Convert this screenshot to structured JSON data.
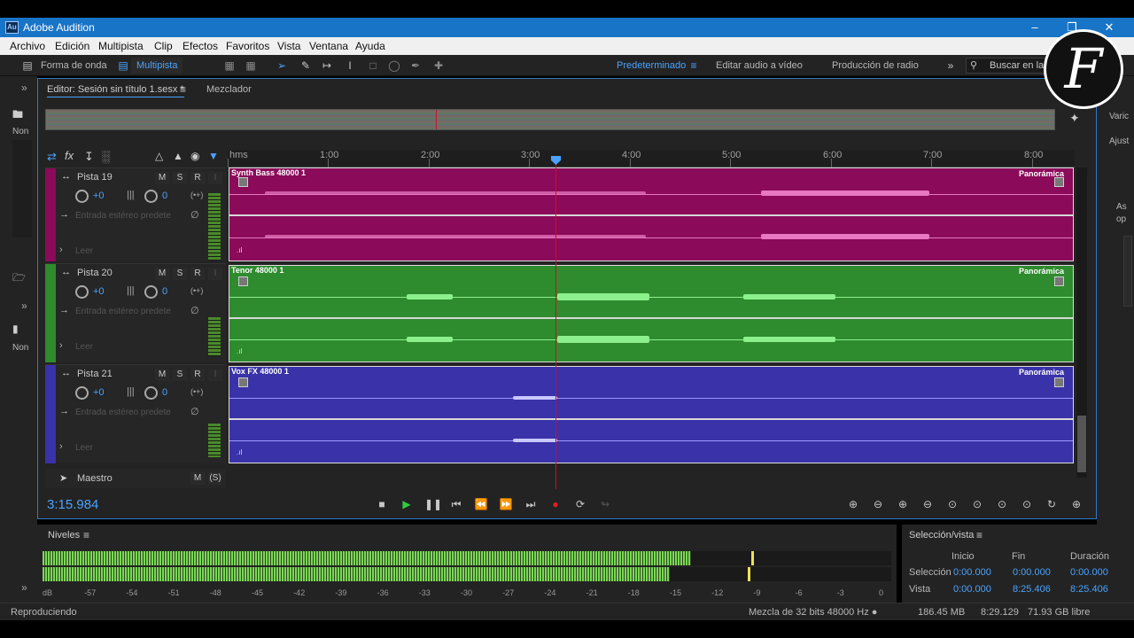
{
  "window": {
    "title": "Adobe Audition",
    "app_icon": "Au"
  },
  "menu": [
    "Archivo",
    "Edición",
    "Multipista",
    "Clip",
    "Efectos",
    "Favoritos",
    "Vista",
    "Ventana",
    "Ayuda"
  ],
  "toolbar": {
    "waveform_label": "Forma de onda",
    "multitrack_label": "Multipista",
    "workspaces": [
      "Predeterminado",
      "Editar audio a vídeo",
      "Producción de radio"
    ],
    "search_placeholder": "Buscar en la A"
  },
  "left_panel": {
    "label_top": "Non",
    "label_bottom": "Non"
  },
  "right_panel": {
    "labels": [
      "Varic",
      "Ajust",
      "As",
      "op"
    ]
  },
  "editor": {
    "tab_editor": "Editor: Sesión sin título 1.sesx *",
    "tab_mixer": "Mezclador",
    "ruler": [
      "hms",
      "1:00",
      "2:00",
      "3:00",
      "4:00",
      "5:00",
      "6:00",
      "7:00",
      "8:00"
    ]
  },
  "tracks": [
    {
      "name": "Pista 19",
      "vol": "+0",
      "pan": "0",
      "input": "Entrada estéreo predete",
      "mode": "Leer",
      "clip_title": "Synth Bass 48000 1",
      "pan_label": "Panorámica",
      "color": "#8b0a5a",
      "wave_color": "#e878c0",
      "stripe": "#8b0a5a"
    },
    {
      "name": "Pista 20",
      "vol": "+0",
      "pan": "0",
      "input": "Entrada estéreo predete",
      "mode": "Leer",
      "clip_title": "Tenor 48000 1",
      "pan_label": "Panorámica",
      "color": "#2e8b2e",
      "wave_color": "#8cf08c",
      "stripe": "#2e8b2e"
    },
    {
      "name": "Pista 21",
      "vol": "+0",
      "pan": "0",
      "input": "Entrada estéreo predete",
      "mode": "Leer",
      "clip_title": "Vox FX 48000 1",
      "pan_label": "Panorámica",
      "color": "#3a32a8",
      "wave_color": "#9a9aff",
      "stripe": "#3a32a8"
    }
  ],
  "master": {
    "name": "Maestro"
  },
  "transport": {
    "timecode": "3:15.984"
  },
  "levels": {
    "title": "Niveles",
    "scale": [
      "dB",
      "-57",
      "-54",
      "-51",
      "-48",
      "-45",
      "-42",
      "-39",
      "-36",
      "-33",
      "-30",
      "-27",
      "-24",
      "-21",
      "-18",
      "-15",
      "-12",
      "-9",
      "-6",
      "-3",
      "0"
    ],
    "left_level_db": -13.5,
    "right_level_db": -15
  },
  "selection": {
    "title": "Selección/vista",
    "headers": [
      "Inicio",
      "Fin",
      "Duración"
    ],
    "rows": [
      {
        "label": "Selección",
        "values": [
          "0:00.000",
          "0:00.000",
          "0:00.000"
        ]
      },
      {
        "label": "Vista",
        "values": [
          "0:00.000",
          "8:25.406",
          "8:25.406"
        ]
      }
    ]
  },
  "status": {
    "left": "Reproduciendo",
    "mix": "Mezcla de 32 bits 48000 Hz ●",
    "mem": "186.45 MB",
    "dur": "8:29.129",
    "free": "71.93 GB libre"
  },
  "logo": {
    "letter": "F"
  },
  "colors": {
    "accent": "#4aa3ff",
    "playhead": "#c8102e",
    "titlebar": "#1874c6"
  }
}
